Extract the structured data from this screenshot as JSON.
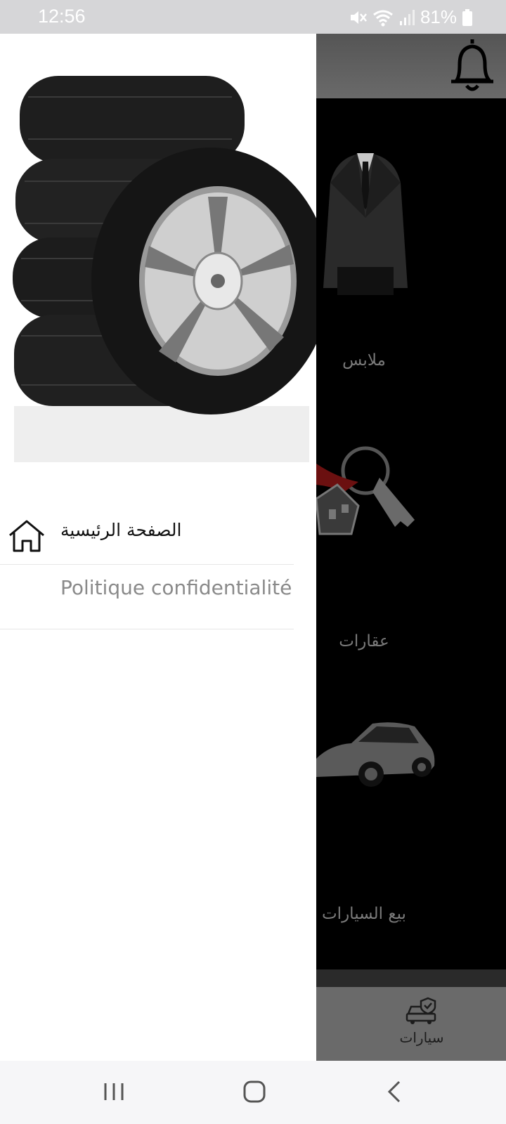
{
  "status_bar": {
    "time": "12:56",
    "battery": "81%"
  },
  "app": {
    "categories": [
      {
        "label": "ملابس",
        "image_icon": "suit-icon"
      },
      {
        "label": "عقارات",
        "image_icon": "house-keys-icon"
      },
      {
        "label": "بيع السيارات",
        "image_icon": "car-icon"
      }
    ],
    "bottom_tab": {
      "label": "سيارات",
      "icon": "car-shield-icon"
    }
  },
  "drawer": {
    "header_image": "tires-image",
    "items": [
      {
        "label": "الصفحة الرئيسية",
        "icon": "home-icon"
      },
      {
        "label": "Politique confidentialité"
      }
    ]
  },
  "colors": {
    "drawer_bg": "#ffffff",
    "scrim": "#000000",
    "header_bar": "#666666",
    "muted_text": "#8a8a8a"
  }
}
